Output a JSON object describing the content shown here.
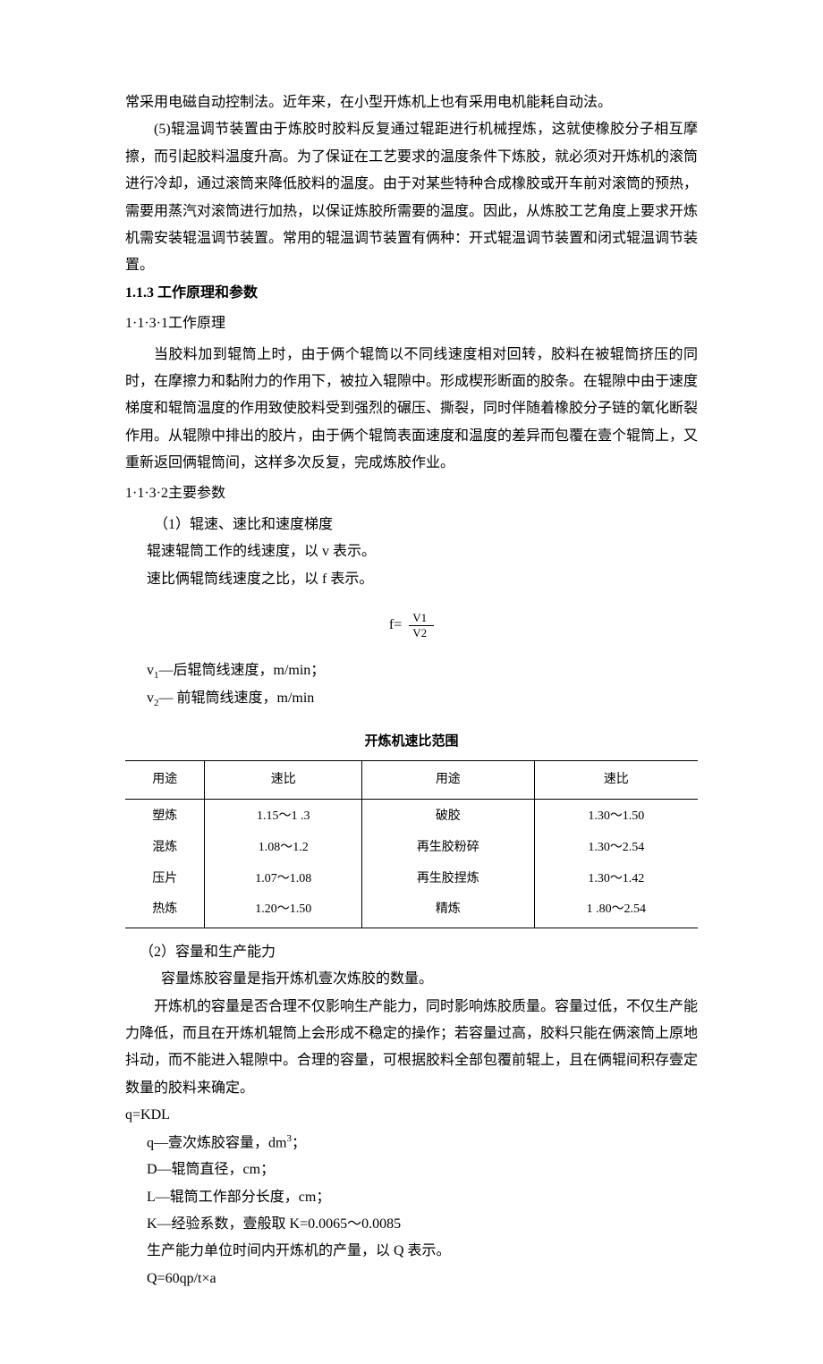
{
  "p1": "常采用电磁自动控制法。近年来，在小型开炼机上也有采用电机能耗自动法。",
  "p2": "(5)辊温调节装置由于炼胶时胶料反复通过辊距进行机械捏炼，这就使橡胶分子相互摩擦，而引起胶料温度升高。为了保证在工艺要求的温度条件下炼胶，就必须对开炼机的滚筒进行冷却，通过滚筒来降低胶料的温度。由于对某些特种合成橡胶或开车前对滚筒的预热，需要用蒸汽对滚筒进行加热，以保证炼胶所需要的温度。因此，从炼胶工艺角度上要求开炼机需安装辊温调节装置。常用的辊温调节装置有俩种：开式辊温调节装置和闭式辊温调节装置。",
  "h1": "1.1.3 工作原理和参数",
  "h2": "1·1·3·1工作原理",
  "p3": "当胶料加到辊筒上时，由于俩个辊筒以不同线速度相对回转，胶料在被辊筒挤压的同时，在摩擦力和黏附力的作用下，被拉入辊隙中。形成楔形断面的胶条。在辊隙中由于速度梯度和辊筒温度的作用致使胶料受到强烈的碾压、撕裂，同时伴随着橡胶分子链的氧化断裂作用。从辊隙中排出的胶片，由于俩个辊筒表面速度和温度的差异而包覆在壹个辊筒上，又重新返回俩辊筒间，这样多次反复，完成炼胶作业。",
  "h3": "1·1·3·2主要参数",
  "p4a": "（1）辊速、速比和速度梯度",
  "p4b": "辊速辊筒工作的线速度，以 v 表示。",
  "p4c": "速比俩辊筒线速度之比，以 f 表示。",
  "formula_f": "f=",
  "formula_num": "V1",
  "formula_den": "V2",
  "v1_label": "v",
  "v1_sub": "1",
  "v1_text": "—后辊筒线速度，m/min；",
  "v2_label": "v",
  "v2_sub": "2",
  "v2_text": "— 前辊筒线速度，m/min",
  "table_title": "开炼机速比范围",
  "table": {
    "headers": [
      "用途",
      "速比",
      "用途",
      "速比"
    ],
    "rows": [
      [
        "塑炼",
        "1.15～1 .3",
        "破胶",
        "1.30～1.50"
      ],
      [
        "混炼",
        "1.08～1.2",
        "再生胶粉碎",
        "1.30～2.54"
      ],
      [
        "压片",
        "1.07～1.08",
        "再生胶捏炼",
        "1.30～1.42"
      ],
      [
        "热炼",
        "1.20～1.50",
        "精炼",
        "1 .80～2.54"
      ]
    ]
  },
  "p5": "（2）容量和生产能力",
  "p6": "容量炼胶容量是指开炼机壹次炼胶的数量。",
  "p7": "开炼机的容量是否合理不仅影响生产能力，同时影响炼胶质量。容量过低，不仅生产能力降低，而且在开炼机辊筒上会形成不稳定的操作；若容量过高，胶料只能在俩滚筒上原地抖动，而不能进入辊隙中。合理的容量，可根据胶料全部包覆前辊上，且在俩辊间积存壹定数量的胶料来确定。",
  "eq1": "q=KDL",
  "def_q_a": "q—壹次炼胶容量，dm",
  "def_q_sup": "3",
  "def_q_b": "；",
  "def_D": "D—辊筒直径，cm；",
  "def_L": "L—辊筒工作部分长度，cm；",
  "def_K": "K—经验系数，壹般取 K=0.0065～0.0085",
  "def_cap": "生产能力单位时间内开炼机的产量，以 Q 表示。",
  "eq2": "Q=60qp/t×a"
}
